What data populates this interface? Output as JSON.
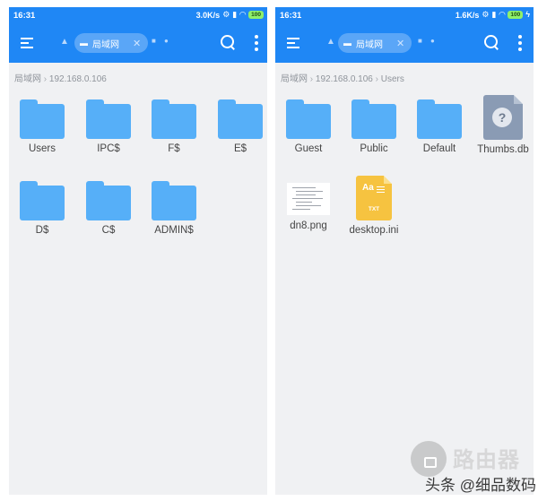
{
  "left_screen": {
    "status": {
      "time": "16:31",
      "speed": "3.0K/s",
      "battery": "100"
    },
    "tab": {
      "label": "局域网"
    },
    "breadcrumb": [
      "局域网",
      "192.168.0.106"
    ],
    "items": [
      {
        "name": "Users",
        "type": "folder"
      },
      {
        "name": "IPC$",
        "type": "folder"
      },
      {
        "name": "F$",
        "type": "folder"
      },
      {
        "name": "E$",
        "type": "folder"
      },
      {
        "name": "D$",
        "type": "folder"
      },
      {
        "name": "C$",
        "type": "folder"
      },
      {
        "name": "ADMIN$",
        "type": "folder"
      }
    ]
  },
  "right_screen": {
    "status": {
      "time": "16:31",
      "speed": "1.6K/s",
      "battery": "100"
    },
    "tab": {
      "label": "局域网"
    },
    "breadcrumb": [
      "局域网",
      "192.168.0.106",
      "Users"
    ],
    "items": [
      {
        "name": "Guest",
        "type": "folder"
      },
      {
        "name": "Public",
        "type": "folder"
      },
      {
        "name": "Default",
        "type": "folder"
      },
      {
        "name": "Thumbs.db",
        "type": "unknown-file",
        "glyph": "?"
      },
      {
        "name": "dn8.png",
        "type": "image-file"
      },
      {
        "name": "desktop.ini",
        "type": "text-file",
        "glyph": "Aa",
        "caption": "TXT"
      }
    ]
  },
  "watermark": {
    "brand": "路由器",
    "source": "头条 @细品数码"
  },
  "colors": {
    "topbar": "#1f87f5",
    "folder": "#56aff8",
    "background": "#f0f1f3"
  },
  "icons": [
    "menu-icon",
    "home-icon",
    "lan-icon",
    "close-icon",
    "chat-icon",
    "cloud-icon",
    "search-icon",
    "more-icon",
    "wifi-icon",
    "signal-icon"
  ]
}
